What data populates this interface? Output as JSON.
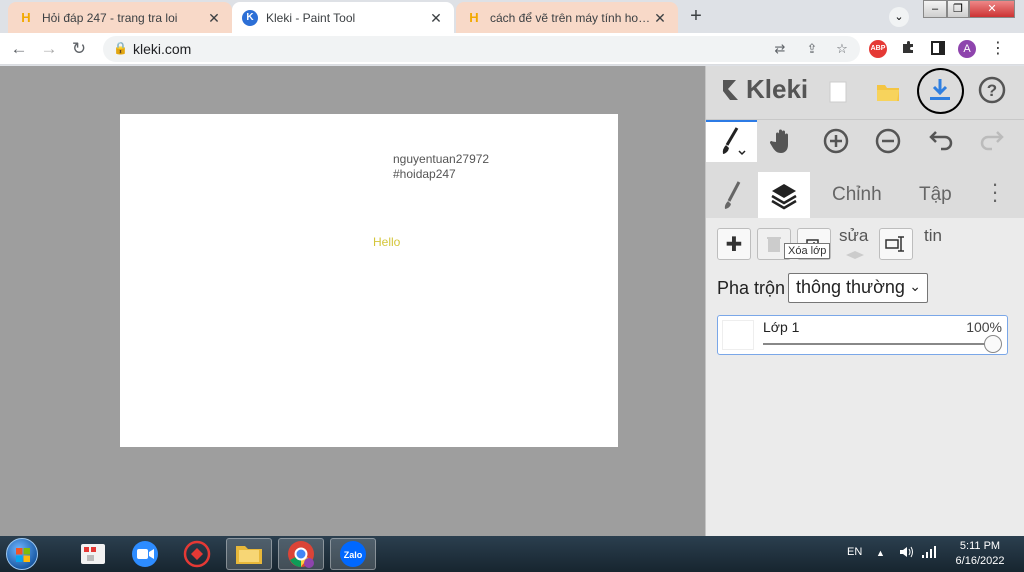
{
  "browser": {
    "tabs": [
      {
        "title": "Hỏi đáp 247 - trang tra loi",
        "favicon": "H"
      },
      {
        "title": "Kleki - Paint Tool",
        "favicon": "K"
      },
      {
        "title": "cách để vẽ trên máy tính hoặc lap",
        "favicon": "H"
      }
    ],
    "url": "kleki.com",
    "profile_initial": "A",
    "abp_label": "ABP"
  },
  "app": {
    "logo_text": "Kleki",
    "panel_tabs": {
      "adjust": "Chỉnh",
      "file": "Tập"
    },
    "layer_toolbar": {
      "rename_text": "sửa",
      "info_text": "tin",
      "tooltip": "Xóa lớp"
    },
    "blend": {
      "label": "Pha trộn",
      "value": "thông thường"
    },
    "layers": [
      {
        "name": "Lớp 1",
        "opacity": "100%"
      }
    ]
  },
  "canvas": {
    "text_line1": "nguyentuan27972",
    "text_line2": "#hoidap247",
    "hello": "Hello",
    "hello_color": "#d4c63a"
  },
  "taskbar": {
    "language": "EN",
    "time": "5:11 PM",
    "date": "6/16/2022",
    "zalo_label": "Zalo"
  }
}
